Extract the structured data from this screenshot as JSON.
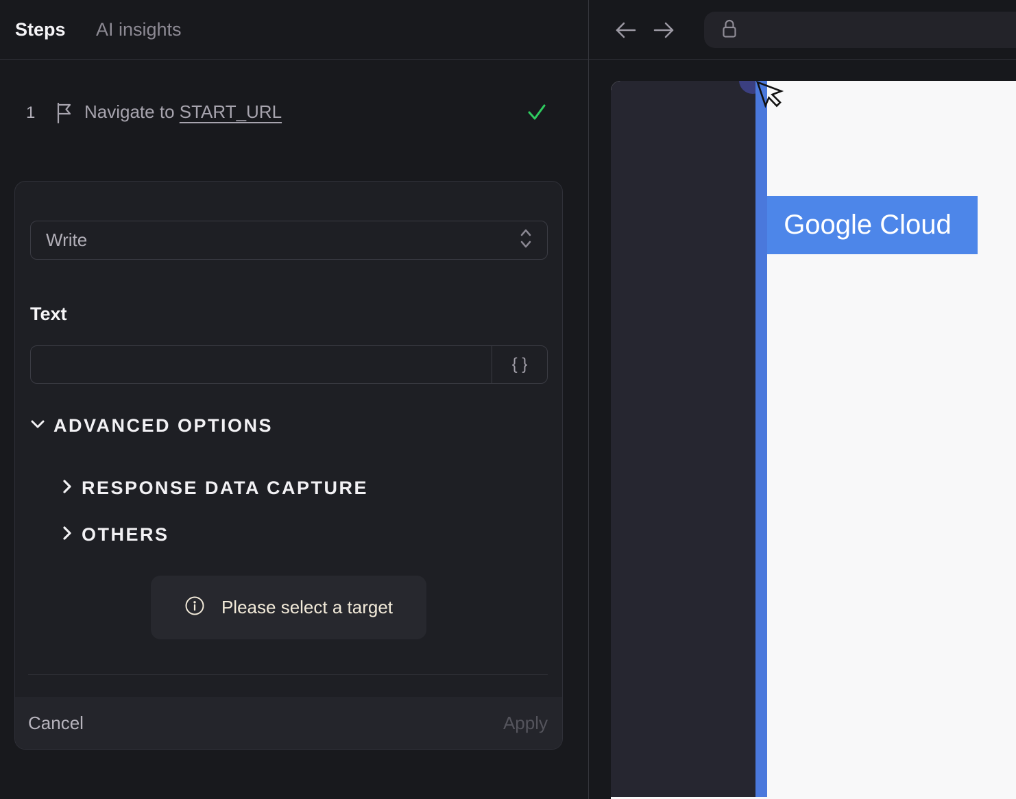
{
  "left_panel": {
    "tabs": [
      {
        "label": "Steps",
        "active": true
      },
      {
        "label": "AI insights",
        "active": false
      }
    ],
    "step": {
      "number": "1",
      "text": "Navigate to ",
      "link": "START_URL",
      "status_icon": "green-check"
    },
    "editor": {
      "action_value": "Write",
      "text_label": "Text",
      "text_value": "",
      "variables_button": "{ }",
      "advanced_options": "ADVANCED OPTIONS",
      "section_response": "RESPONSE DATA CAPTURE",
      "section_others": "OTHERS",
      "notice": "Please select a target",
      "cancel": "Cancel",
      "apply": "Apply"
    }
  },
  "browser": {
    "nav": {
      "back_icon": "arrow-left",
      "forward_icon": "arrow-right",
      "lock_icon": "padlock"
    },
    "page": {
      "highlight_label": "Google Cloud"
    }
  },
  "colors": {
    "app_bg": "#18191d",
    "card_bg": "#1e1f24",
    "highlight_blue": "#4d86e9",
    "stripe_blue": "#4a78dc",
    "badge_indigo": "#3b3f80",
    "check_green": "#2ecc5f",
    "notice_text": "#f2ead9",
    "page_white": "#f8f8f9",
    "page_sidebar": "#262630"
  }
}
